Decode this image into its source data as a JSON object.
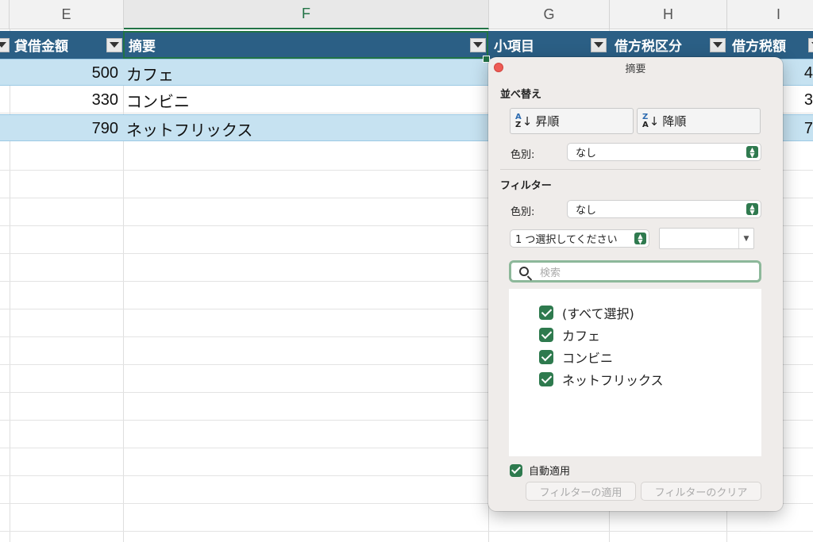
{
  "sheet": {
    "columns": [
      "E",
      "F",
      "G",
      "H",
      "I"
    ],
    "active_column": "F",
    "headers": {
      "e": "貸借金額",
      "f": "摘要",
      "g": "小項目",
      "h": "借方税区分",
      "i": "借方税額"
    },
    "rows": [
      {
        "amount": "500",
        "memo": "カフェ",
        "tax": "4"
      },
      {
        "amount": "330",
        "memo": "コンビニ",
        "tax": "3"
      },
      {
        "amount": "790",
        "memo": "ネットフリックス",
        "tax": "7"
      }
    ]
  },
  "popup": {
    "title": "摘要",
    "sort_section": "並べ替え",
    "ascending": "昇順",
    "descending": "降順",
    "sort_color_label": "色別:",
    "sort_color_value": "なし",
    "filter_section": "フィルター",
    "filter_color_label": "色別:",
    "filter_color_value": "なし",
    "condition_select": "1 つ選択してください",
    "search_placeholder": "検索",
    "items": [
      "(すべて選択)",
      "カフェ",
      "コンビニ",
      "ネットフリックス"
    ],
    "auto_apply": "自動適用",
    "apply_button": "フィルターの適用",
    "clear_button": "フィルターのクリア"
  },
  "colors": {
    "header_bg": "#2b5f85",
    "band_bg": "#c6e2f1",
    "excel_green": "#217346",
    "checkbox_green": "#2e7a4e"
  }
}
